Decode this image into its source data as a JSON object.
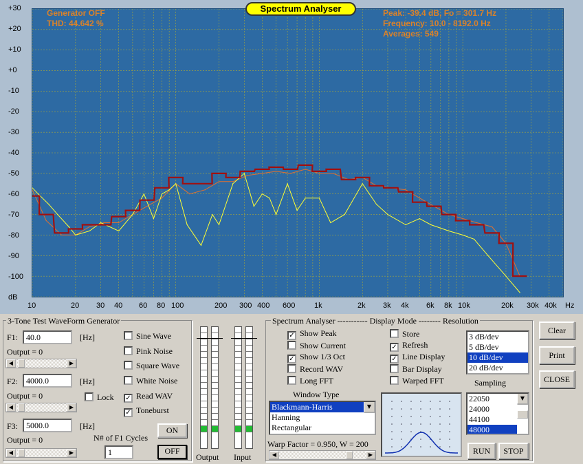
{
  "graph": {
    "title": "Spectrum Analyser",
    "generator_status": "Generator OFF",
    "thd": "THD: 44.642 %",
    "peak": "Peak: -39.4 dB, Fo = 301.7 Hz",
    "frequency": "Frequency: 10.0 - 8192.0 Hz",
    "averages": "Averages: 549",
    "y_ticks": [
      "+30",
      "+20",
      "+10",
      "+0",
      "-10",
      "-20",
      "-30",
      "-40",
      "-50",
      "-60",
      "-70",
      "-80",
      "-90",
      "-100",
      "dB"
    ],
    "x_ticks": [
      "10",
      "20",
      "30",
      "40",
      "60",
      "80",
      "100",
      "200",
      "300",
      "400",
      "600",
      "1k",
      "2k",
      "3k",
      "4k",
      "6k",
      "8k",
      "10k",
      "20k",
      "30k",
      "40k",
      "Hz"
    ],
    "colors": {
      "background": "#2d6aa3",
      "grid": "#a8a838",
      "peak": "#e07030",
      "current": "#ffff33",
      "octave": "#a01010"
    }
  },
  "chart_data": {
    "type": "line",
    "xscale": "log",
    "xlim": [
      10,
      50000
    ],
    "ylim": [
      -110,
      30
    ],
    "ylabel": "dB",
    "xlabel": "Hz",
    "grid": true,
    "series": [
      {
        "x": [
          10,
          12.5,
          16,
          20,
          25,
          31.5,
          40,
          50,
          63,
          80,
          100,
          125,
          160,
          200,
          250,
          315,
          400,
          500,
          630,
          800,
          1000,
          1250,
          1600,
          2000,
          2500,
          3150,
          4000,
          5000,
          6300,
          8000,
          10000,
          12500,
          16000,
          20000,
          25000
        ],
        "values": [
          -58,
          -73,
          -80,
          -80,
          -76,
          -74,
          -74,
          -70,
          -66,
          -62,
          -55,
          -60,
          -58,
          -54,
          -54,
          -51,
          -50,
          -49,
          -50,
          -48,
          -50,
          -50,
          -53,
          -52,
          -56,
          -57,
          -58,
          -62,
          -66,
          -70,
          -72,
          -74,
          -76,
          -84,
          -100
        ]
      },
      {
        "x": [
          10,
          11,
          13,
          15,
          18,
          20,
          25,
          30,
          40,
          50,
          60,
          70,
          80,
          90,
          100,
          120,
          150,
          180,
          200,
          250,
          300,
          350,
          400,
          450,
          500,
          600,
          700,
          800,
          1000,
          1200,
          1500,
          2000,
          2500,
          3000,
          4000,
          5000,
          6000,
          8000,
          10000,
          12000,
          15000,
          20000,
          25000
        ],
        "values": [
          -57,
          -60,
          -65,
          -70,
          -76,
          -80,
          -78,
          -74,
          -78,
          -70,
          -60,
          -72,
          -60,
          -58,
          -55,
          -75,
          -85,
          -70,
          -75,
          -55,
          -50,
          -66,
          -60,
          -62,
          -70,
          -55,
          -68,
          -62,
          -62,
          -74,
          -70,
          -55,
          -65,
          -70,
          -75,
          -72,
          -75,
          -78,
          -80,
          -82,
          -90,
          -100,
          -108
        ]
      },
      {
        "x": [
          10,
          12.5,
          16,
          20,
          25,
          31.5,
          40,
          50,
          63,
          80,
          100,
          125,
          160,
          200,
          250,
          315,
          400,
          500,
          630,
          800,
          1000,
          1250,
          1600,
          2000,
          2500,
          3150,
          4000,
          5000,
          6300,
          8000,
          10000,
          12500,
          16000,
          20000,
          25000
        ],
        "values": [
          -61,
          -70,
          -79,
          -77,
          -75,
          -75,
          -71,
          -68,
          -63,
          -57,
          -52,
          -55,
          -55,
          -50,
          -52,
          -49,
          -48,
          -47,
          -48,
          -46,
          -49,
          -48,
          -53,
          -52,
          -56,
          -57,
          -59,
          -64,
          -66,
          -70,
          -73,
          -75,
          -79,
          -84,
          -100
        ]
      }
    ]
  },
  "generator": {
    "title": "3-Tone Test WaveForm Generator",
    "f1_label": "F1:",
    "f1_value": "40.0",
    "f1_unit": "[Hz]",
    "f1_output": "Output = 0",
    "f2_label": "F2:",
    "f2_value": "4000.0",
    "f2_unit": "[Hz]",
    "f2_output": "Output = 0",
    "f3_label": "F3:",
    "f3_value": "5000.0",
    "f3_unit": "[Hz]",
    "f3_output": "Output = 0",
    "lock": "Lock",
    "sine": "Sine Wave",
    "pink": "Pink Noise",
    "square": "Square Wave",
    "white": "White Noise",
    "readwav": "Read WAV",
    "toneburst": "Toneburst",
    "cycles_label": "N# of F1 Cycles",
    "cycles_value": "1",
    "on": "ON",
    "off": "OFF"
  },
  "meters": {
    "output": "Output",
    "input": "Input"
  },
  "analyser": {
    "title": "Spectrum Analyser ----------- Display Mode -------- Resolution",
    "show_peak": "Show Peak",
    "show_current": "Show Current",
    "show_oct": "Show 1/3 Oct",
    "record_wav": "Record WAV",
    "long_fft": "Long FFT",
    "store": "Store",
    "refresh": "Refresh",
    "line_display": "Line Display",
    "bar_display": "Bar Display",
    "warped_fft": "Warped FFT",
    "window_type_label": "Window Type",
    "windows": [
      "Blackmann-Harris",
      "Hanning",
      "Rectangular"
    ],
    "warp": "Warp Factor = 0.950, W = 200",
    "resolutions": [
      "3 dB/dev",
      "5 dB/dev",
      "10 dB/dev",
      "20 dB/dev"
    ],
    "sampling_label": "Sampling",
    "sampling": [
      "22050",
      "24000",
      "44100",
      "48000"
    ],
    "run": "RUN",
    "stop": "STOP"
  },
  "buttons": {
    "clear": "Clear",
    "print": "Print",
    "close": "CLOSE"
  },
  "check_mark": "✓",
  "arrows": {
    "left": "◀",
    "right": "▶",
    "up": "▲",
    "down": "▼"
  }
}
